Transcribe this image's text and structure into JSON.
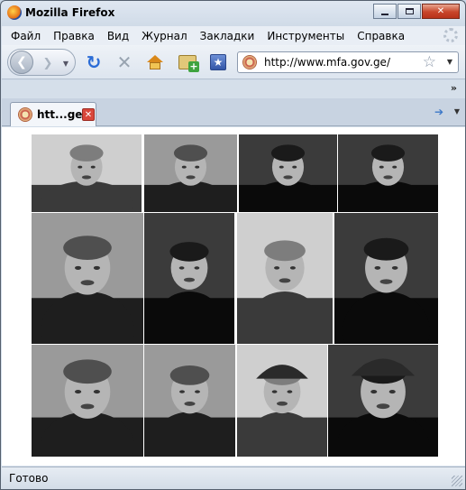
{
  "window": {
    "title": "Mozilla Firefox"
  },
  "menu": [
    "Файл",
    "Правка",
    "Вид",
    "Журнал",
    "Закладки",
    "Инструменты",
    "Справка"
  ],
  "toolbar": {
    "back_icon": "back-arrow-icon",
    "forward_icon": "forward-arrow-icon",
    "reload_icon": "reload-icon",
    "stop_icon": "stop-icon",
    "home_icon": "home-icon",
    "newtab_icon": "new-tab-icon",
    "bookmark_icon": "bookmark-icon"
  },
  "address": {
    "url": "http://www.mfa.gov.ge/"
  },
  "bookmarks": {
    "overflow": "»"
  },
  "tabs": [
    {
      "label": "htt...ge/"
    }
  ],
  "status": {
    "text": "Готово"
  },
  "photos": [
    {
      "id": "p1",
      "tone": "light",
      "subject": "man pointing"
    },
    {
      "id": "p2",
      "tone": "mid",
      "subject": "man pointing"
    },
    {
      "id": "p3",
      "tone": "dark",
      "subject": "man face"
    },
    {
      "id": "p4",
      "tone": "dark",
      "subject": "man face"
    },
    {
      "id": "p5",
      "tone": "mid",
      "subject": "man gesturing"
    },
    {
      "id": "p6",
      "tone": "dark",
      "subject": "man gesturing"
    },
    {
      "id": "p7",
      "tone": "light",
      "subject": "man gesturing"
    },
    {
      "id": "p8",
      "tone": "dark",
      "subject": "man saluting"
    },
    {
      "id": "p9",
      "tone": "mid",
      "subject": "man in jacket"
    },
    {
      "id": "p10",
      "tone": "mid",
      "subject": "man in coat"
    },
    {
      "id": "p11",
      "tone": "light",
      "subject": "man in cap"
    },
    {
      "id": "p12",
      "tone": "dark",
      "subject": "man in cap"
    }
  ]
}
